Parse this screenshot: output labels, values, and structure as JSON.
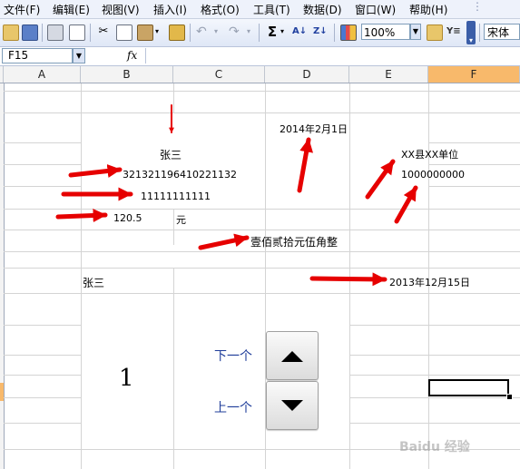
{
  "menu": [
    "文件(F)",
    "编辑(E)",
    "视图(V)",
    "插入(I)",
    "格式(O)",
    "工具(T)",
    "数据(D)",
    "窗口(W)",
    "帮助(H)"
  ],
  "toolbar": {
    "zoom": "100%",
    "font": "宋体",
    "sum_symbol": "Σ",
    "icons": [
      "open-icon",
      "save-icon",
      "print-icon",
      "print-preview-icon",
      "cut-icon",
      "copy-icon",
      "paste-icon",
      "format-painter-icon",
      "undo-icon",
      "redo-icon",
      "autosum-icon",
      "sort-asc-icon",
      "sort-desc-icon",
      "chart-wizard-icon",
      "zoom-dropdown",
      "research-icon",
      "filter-icon",
      "toolbar-options-icon"
    ]
  },
  "formula_bar": {
    "name_box": "F15",
    "fx": "fx",
    "formula": ""
  },
  "columns": [
    "A",
    "B",
    "C",
    "D",
    "E",
    "F"
  ],
  "selected_column": "F",
  "cells": {
    "payee": "张三",
    "id_number": "321321196410221132",
    "account": "11111111111",
    "amount": "120.5",
    "amount_unit": "元",
    "amount_words": "壹佰贰拾元伍角整",
    "date_top": "2014年2月1日",
    "org": "XX县XX单位",
    "org_number": "1000000000",
    "date_bottom": "2013年12月15日",
    "name_bottom": "张三",
    "counter": "1",
    "next_label": "下一个",
    "prev_label": "上一个"
  },
  "colors": {
    "arrow": "#e60000",
    "button_label": "#1f3d9a",
    "selection_header": "#f8b96b"
  },
  "watermark": "Baidu 经验"
}
